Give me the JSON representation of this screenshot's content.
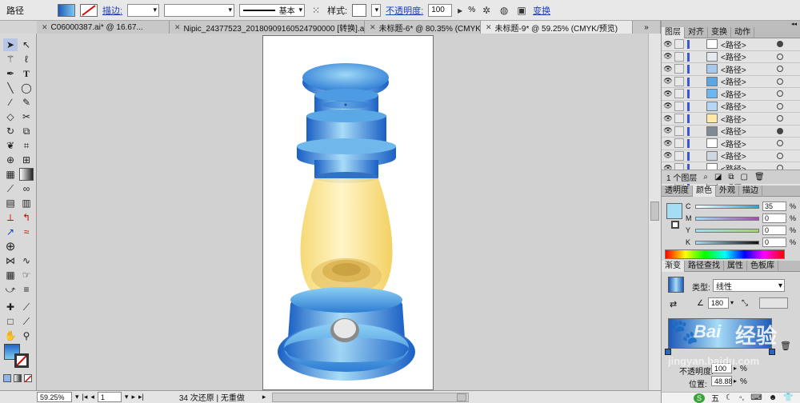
{
  "control_bar": {
    "object_type": "路径",
    "stroke_label": "描边:",
    "stroke_style": "基本",
    "style_label": "样式:",
    "opacity_label": "不透明度:",
    "opacity_value": "100",
    "percent": "%",
    "transform_link": "变换"
  },
  "tabs": [
    {
      "label": "C06000387.ai* @ 16.67...",
      "active": false
    },
    {
      "label": "Nipic_24377523_20180909160524790000 [转换].ai*",
      "active": false
    },
    {
      "label": "未标题-6* @ 80.35% (CMYK...",
      "active": false
    },
    {
      "label": "未标题-9* @ 59.25% (CMYK/预览)",
      "active": true
    }
  ],
  "status_bar": {
    "zoom": "59.25%",
    "page": "1",
    "history": "34 次还原 | 无重做"
  },
  "layers_panel": {
    "tabs": [
      "图层",
      "对齐",
      "变换",
      "动作"
    ],
    "rows": [
      {
        "name": "<路径>",
        "filled": true
      },
      {
        "name": "<路径>",
        "filled": false
      },
      {
        "name": "<路径>",
        "filled": false
      },
      {
        "name": "<路径>",
        "filled": false
      },
      {
        "name": "<路径>",
        "filled": false
      },
      {
        "name": "<路径>",
        "filled": false
      },
      {
        "name": "<路径>",
        "filled": false
      },
      {
        "name": "<路径>",
        "filled": true
      },
      {
        "name": "<路径>",
        "filled": false
      },
      {
        "name": "<路径>",
        "filled": false
      },
      {
        "name": "<路径>",
        "filled": false
      },
      {
        "name": "<路径>",
        "filled": false
      }
    ],
    "footer": "1 个图层"
  },
  "color_panel": {
    "tabs": [
      "透明度",
      "颜色",
      "外观",
      "描边"
    ],
    "sliders": [
      {
        "channel": "C",
        "value": "35",
        "color": "#21a5d8"
      },
      {
        "channel": "M",
        "value": "0",
        "color": "#d4237a"
      },
      {
        "channel": "Y",
        "value": "0",
        "color": "#e6dd2a"
      },
      {
        "channel": "K",
        "value": "0",
        "color": "#333333"
      }
    ],
    "percent": "%"
  },
  "gradient_panel": {
    "tabs": [
      "渐变",
      "路径查找",
      "属性",
      "色板库"
    ],
    "type_label": "类型:",
    "type_value": "线性",
    "angle": "180",
    "opacity_label": "不透明度:",
    "opacity_value": "100",
    "position_label": "位置:",
    "position_value": "48.88",
    "percent": "%"
  },
  "watermark": {
    "text": "经验",
    "brand": "Bai",
    "url": "jingyan.baidu.com"
  },
  "taskbar": {
    "ime": "五"
  }
}
